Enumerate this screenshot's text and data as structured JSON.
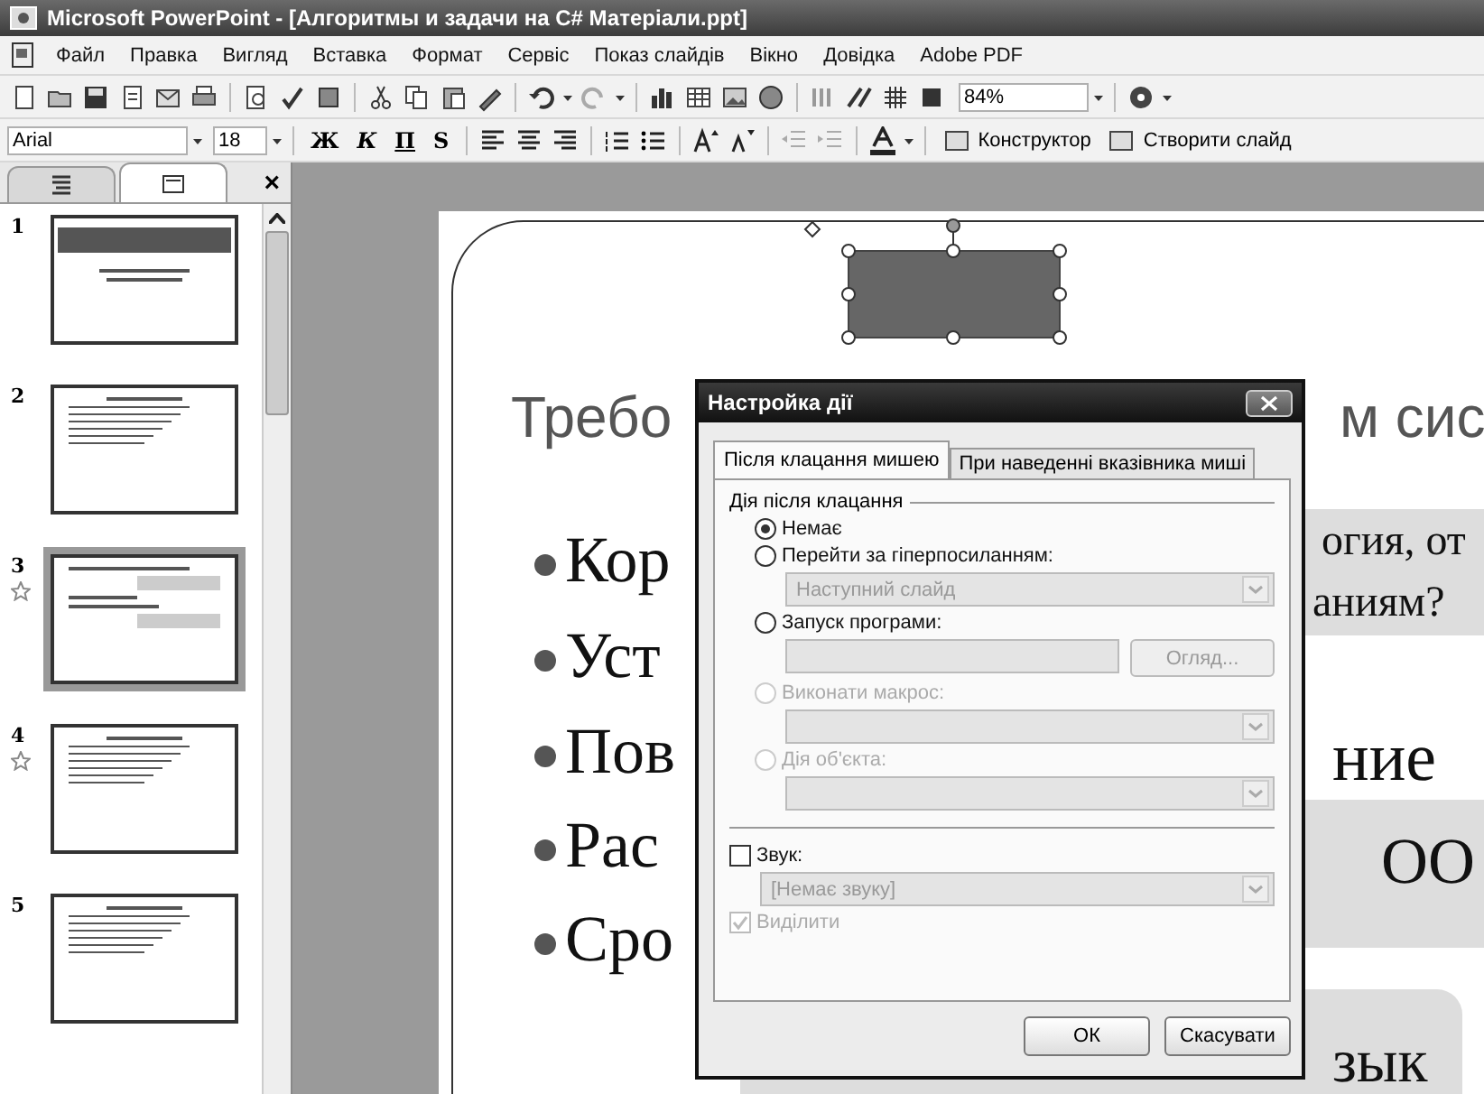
{
  "window": {
    "title": "Microsoft PowerPoint - [Алгоритмы и задачи на C# Матеріали.ppt]"
  },
  "menu": [
    "Файл",
    "Правка",
    "Вигляд",
    "Вставка",
    "Формат",
    "Сервіс",
    "Показ слайдів",
    "Вікно",
    "Довідка",
    "Adobe PDF"
  ],
  "toolbar": {
    "zoom": "84%"
  },
  "format_toolbar": {
    "font": "Arial",
    "size": "18",
    "style_buttons": [
      "Ж",
      "К",
      "П",
      "S"
    ],
    "buttons": [
      "Конструктор",
      "Створити слайд"
    ]
  },
  "slides_pane": {
    "tabs": [
      {
        "kind": "outline",
        "selected": false
      },
      {
        "kind": "slides",
        "selected": true
      }
    ],
    "close": "×",
    "slides": [
      {
        "number": "1",
        "selected": false,
        "animated": false,
        "kind": "title"
      },
      {
        "number": "2",
        "selected": false,
        "animated": false,
        "kind": "list"
      },
      {
        "number": "3",
        "selected": true,
        "animated": true,
        "kind": "boxes"
      },
      {
        "number": "4",
        "selected": false,
        "animated": true,
        "kind": "list"
      },
      {
        "number": "5",
        "selected": false,
        "animated": false,
        "kind": "list"
      }
    ]
  },
  "slide": {
    "title_parts": [
      "Требо",
      "м сис"
    ],
    "bullets": [
      "Кор",
      "Уст",
      "Пов",
      "Рас",
      "Сро"
    ],
    "right_texts": [
      {
        "kind": "box1",
        "lines": [
          "огия, от",
          "аниям?"
        ]
      },
      {
        "kind": "plain",
        "lines": [
          "ние"
        ]
      },
      {
        "kind": "box2",
        "lines": [
          "ОО"
        ]
      },
      {
        "kind": "box3",
        "lines": [
          "зык"
        ]
      }
    ]
  },
  "dialog": {
    "title": "Настройка дії",
    "tabs": [
      {
        "label": "Після клацання мишею",
        "selected": true
      },
      {
        "label": "При наведенні вказівника миші",
        "selected": false
      }
    ],
    "group_label": "Дія після клацання",
    "options": [
      {
        "label": "Немає",
        "selected": true,
        "disabled": false
      },
      {
        "label": "Перейти за гіперпосиланням:",
        "selected": false,
        "disabled": false,
        "control": {
          "kind": "dropdown",
          "value": "Наступний слайд",
          "disabled": true
        }
      },
      {
        "label": "Запуск програми:",
        "selected": false,
        "disabled": false,
        "control": {
          "kind": "input",
          "disabled": true,
          "button": "Огляд..."
        }
      },
      {
        "label": "Виконати макрос:",
        "selected": false,
        "disabled": true,
        "control": {
          "kind": "dropdown",
          "disabled": true
        }
      },
      {
        "label": "Дія об'єкта:",
        "selected": false,
        "disabled": true,
        "control": {
          "kind": "dropdown",
          "disabled": true
        }
      }
    ],
    "sound": {
      "label": "Звук:",
      "checked": false,
      "disabled": false,
      "dropdown": {
        "value": "[Немає звуку]",
        "disabled": true
      }
    },
    "highlight": {
      "label": "Виділити",
      "checked": true,
      "disabled": true
    },
    "buttons": [
      "ОК",
      "Скасувати"
    ]
  }
}
